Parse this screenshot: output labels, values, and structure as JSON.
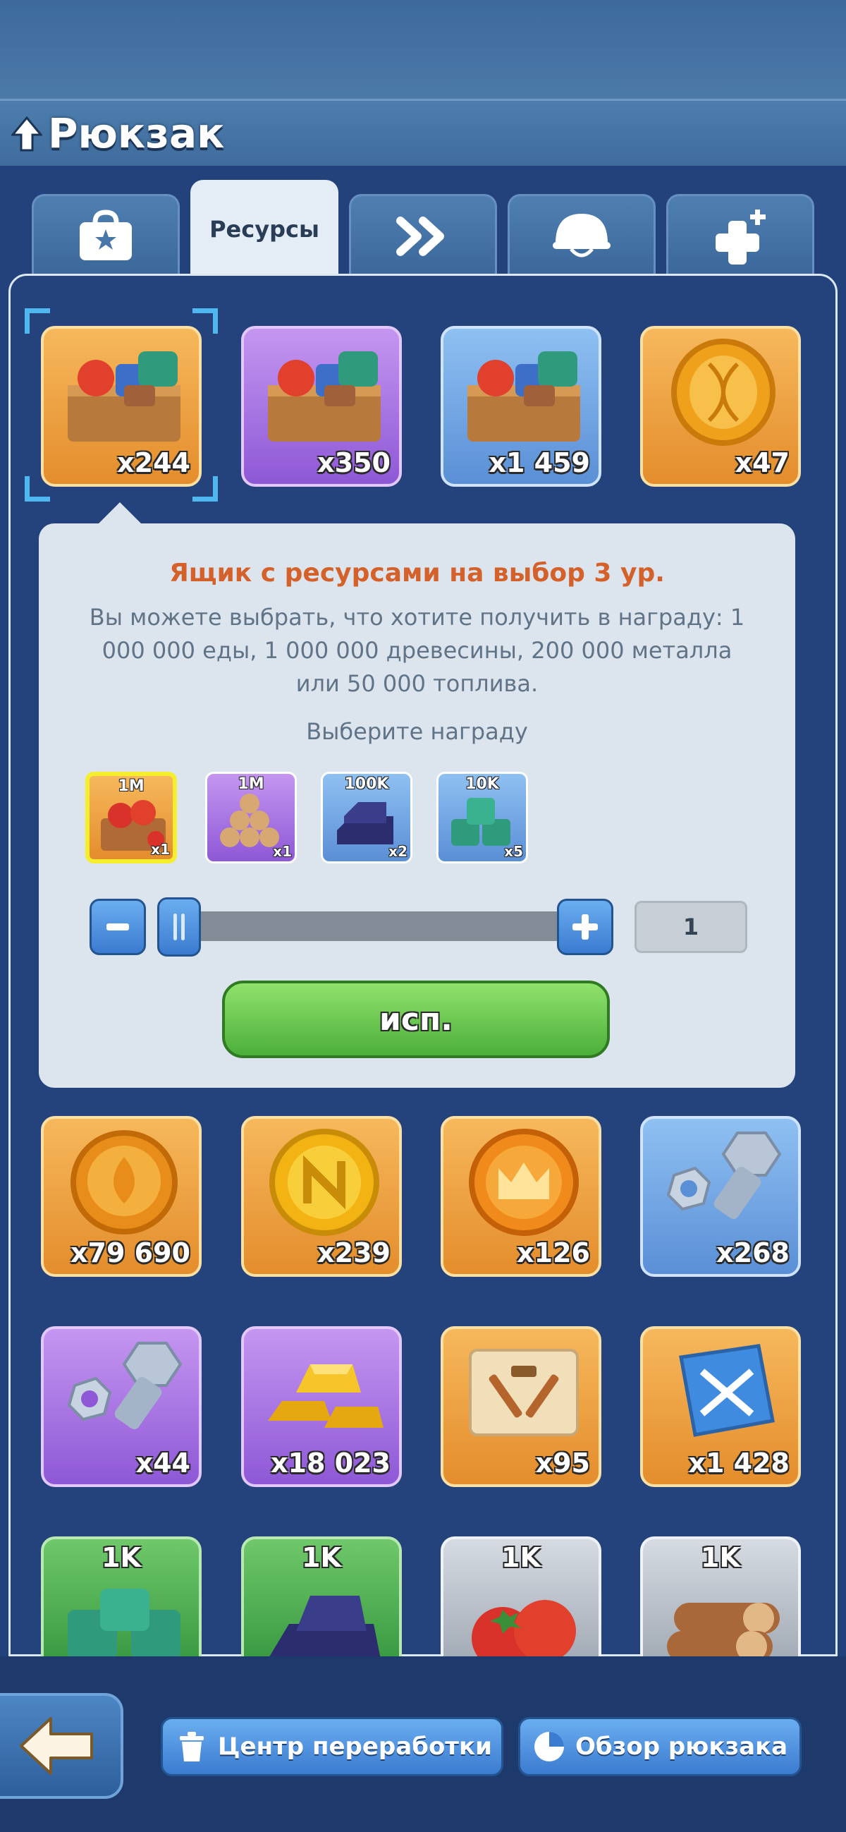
{
  "header": {
    "title": "Рюкзак"
  },
  "tabs": [
    {
      "label": "",
      "icon": "bag-star-icon"
    },
    {
      "label": "Ресурсы",
      "active": true
    },
    {
      "label": "",
      "icon": "double-chevron-icon"
    },
    {
      "label": "",
      "icon": "helmet-icon"
    },
    {
      "label": "",
      "icon": "medical-plus-icon"
    }
  ],
  "items_row1": [
    {
      "icon": "resource-crate-icon",
      "count": "x244",
      "color": "orange"
    },
    {
      "icon": "resource-crate-icon",
      "count": "x350",
      "color": "purple"
    },
    {
      "icon": "resource-crate-icon",
      "count": "x1 459",
      "color": "blue"
    },
    {
      "icon": "dna-coin-icon",
      "count": "x47",
      "color": "orange"
    }
  ],
  "popup": {
    "title": "Ящик с ресурсами на выбор 3 ур.",
    "description": "Вы можете выбрать, что хотите получить в награду: 1 000 000 еды, 1 000 000 древесины, 200 000 металла или 50 000 топлива.",
    "subtitle": "Выберите награду",
    "rewards": [
      {
        "top": "1M",
        "bottom": "x1",
        "icon": "food-crate-icon",
        "selected": true
      },
      {
        "top": "1M",
        "bottom": "x1",
        "icon": "wood-logs-icon"
      },
      {
        "top": "100K",
        "bottom": "x2",
        "icon": "metal-ingots-icon"
      },
      {
        "top": "10K",
        "bottom": "x5",
        "icon": "fuel-canisters-icon"
      }
    ],
    "quantity": "1",
    "slider_fraction": 0,
    "use_label": "исп."
  },
  "items_row2": [
    {
      "icon": "drop-coin-icon",
      "count": "x79 690",
      "color": "orange"
    },
    {
      "icon": "n-coin-icon",
      "count": "x239",
      "color": "orange"
    },
    {
      "icon": "crown-coin-icon",
      "count": "x126",
      "color": "orange"
    },
    {
      "icon": "bolt-nut-icon",
      "count": "x268",
      "color": "blue"
    }
  ],
  "items_row3": [
    {
      "icon": "bolt-nut-icon",
      "count": "x44",
      "color": "purple"
    },
    {
      "icon": "gold-bars-icon",
      "count": "x18 023",
      "color": "purple"
    },
    {
      "icon": "blueprint-scroll-icon",
      "count": "x95",
      "color": "orange"
    },
    {
      "icon": "swords-book-icon",
      "count": "x1 428",
      "color": "orange"
    }
  ],
  "items_row4": [
    {
      "icon": "fuel-canisters-icon",
      "top": "1K",
      "color": "green"
    },
    {
      "icon": "metal-ingots-icon",
      "top": "1K",
      "color": "green"
    },
    {
      "icon": "food-icon",
      "top": "1K",
      "color": "gray"
    },
    {
      "icon": "wood-logs-icon",
      "top": "1K",
      "color": "gray"
    }
  ],
  "bottom": {
    "recycle_label": "Центр переработки",
    "overview_label": "Обзор рюкзака"
  }
}
